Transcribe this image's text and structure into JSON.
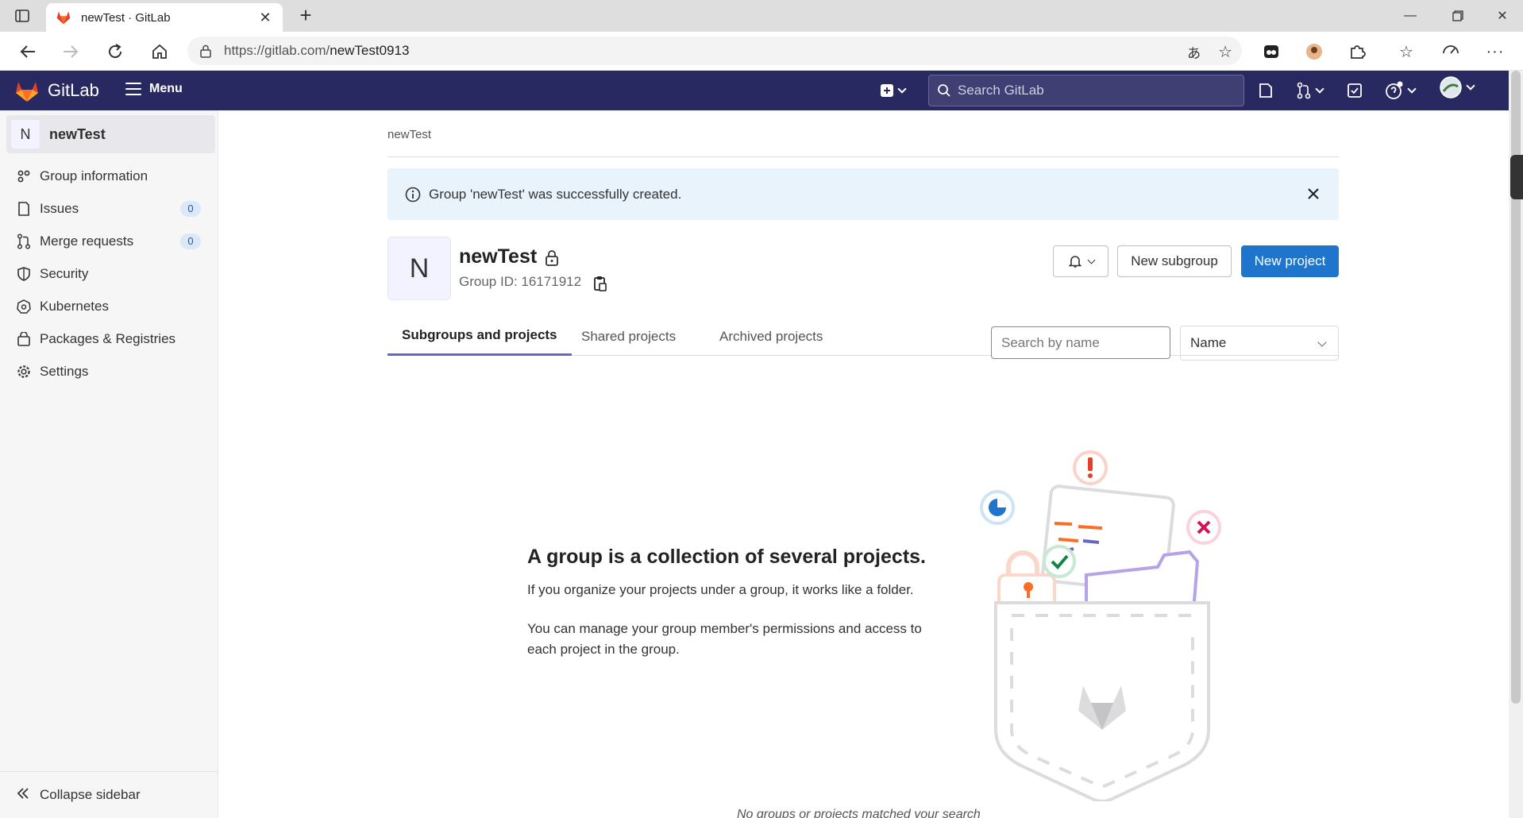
{
  "browser": {
    "tab_title": "newTest · GitLab",
    "url_prefix": "https://gitlab.com/",
    "url_path": "newTest0913"
  },
  "header": {
    "brand": "GitLab",
    "menu_label": "Menu",
    "search_placeholder": "Search GitLab"
  },
  "sidebar": {
    "context_initial": "N",
    "context_name": "newTest",
    "items": [
      {
        "label": "Group information",
        "icon": "group-info-icon"
      },
      {
        "label": "Issues",
        "icon": "issues-icon",
        "count": "0"
      },
      {
        "label": "Merge requests",
        "icon": "merge-request-icon",
        "count": "0"
      },
      {
        "label": "Security",
        "icon": "shield-icon"
      },
      {
        "label": "Kubernetes",
        "icon": "kubernetes-icon"
      },
      {
        "label": "Packages & Registries",
        "icon": "package-icon"
      },
      {
        "label": "Settings",
        "icon": "gear-icon"
      }
    ],
    "collapse_label": "Collapse sidebar"
  },
  "main": {
    "breadcrumb": "newTest",
    "alert": "Group 'newTest' was successfully created.",
    "group": {
      "initial": "N",
      "name": "newTest",
      "id_text": "Group ID: 16171912"
    },
    "buttons": {
      "new_subgroup": "New subgroup",
      "new_project": "New project"
    },
    "tabs": [
      "Subgroups and projects",
      "Shared projects",
      "Archived projects"
    ],
    "search_placeholder": "Search by name",
    "sort_value": "Name",
    "empty": {
      "title": "A group is a collection of several projects.",
      "p1": "If you organize your projects under a group, it works like a folder.",
      "p2": "You can manage your group member's permissions and access to each project in the group.",
      "footer": "No groups or projects matched your search"
    }
  },
  "colors": {
    "header_bg": "#292961",
    "primary": "#1f75cb",
    "tab_active": "#6666c4"
  }
}
